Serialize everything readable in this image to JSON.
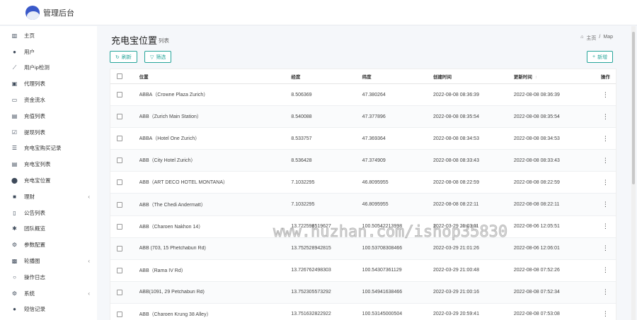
{
  "app": {
    "title": "管理后台"
  },
  "sidebar": {
    "items": [
      {
        "icon": "bar-chart-icon",
        "glyph": "▥",
        "label": "主页",
        "arrow": ""
      },
      {
        "icon": "user-icon",
        "glyph": "●",
        "label": "用户",
        "arrow": ""
      },
      {
        "icon": "ip-check-icon",
        "glyph": "⟋",
        "label": "用户ip检测",
        "arrow": ""
      },
      {
        "icon": "agent-list-icon",
        "glyph": "▣",
        "label": "代理列表",
        "arrow": ""
      },
      {
        "icon": "money-flow-icon",
        "glyph": "▭",
        "label": "资金流水",
        "arrow": ""
      },
      {
        "icon": "recharge-list-icon",
        "glyph": "▤",
        "label": "充值列表",
        "arrow": ""
      },
      {
        "icon": "withdraw-list-icon",
        "glyph": "☑",
        "label": "提现列表",
        "arrow": ""
      },
      {
        "icon": "purchase-record-icon",
        "glyph": "☰",
        "label": "充电宝购买记录",
        "arrow": ""
      },
      {
        "icon": "powerbank-list-icon",
        "glyph": "▤",
        "label": "充电宝列表",
        "arrow": ""
      },
      {
        "icon": "location-pin-icon",
        "glyph": "⬤",
        "label": "充电宝位置",
        "arrow": ""
      },
      {
        "icon": "finance-icon",
        "glyph": "■",
        "label": "理财",
        "arrow": "‹"
      },
      {
        "icon": "announcement-icon",
        "glyph": "▯",
        "label": "公告列表",
        "arrow": ""
      },
      {
        "icon": "team-icon",
        "glyph": "✱",
        "label": "团队概览",
        "arrow": ""
      },
      {
        "icon": "settings-icon",
        "glyph": "⚙",
        "label": "参数配置",
        "arrow": ""
      },
      {
        "icon": "carousel-icon",
        "glyph": "▩",
        "label": "轮播图",
        "arrow": "‹"
      },
      {
        "icon": "log-icon",
        "glyph": "○",
        "label": "操作日志",
        "arrow": ""
      },
      {
        "icon": "system-gear-icon",
        "glyph": "⚙",
        "label": "系统",
        "arrow": "‹"
      },
      {
        "icon": "sms-icon",
        "glyph": "●",
        "label": "短信记录",
        "arrow": ""
      }
    ]
  },
  "header": {
    "title": "充电宝位置",
    "subtitle": "列表",
    "breadcrumb": {
      "home": "主页",
      "sep": "/",
      "current": "Map"
    }
  },
  "toolbar": {
    "refresh_icon": "↻",
    "refresh_label": "刷新",
    "filter_icon": "▽",
    "filter_label": "筛选",
    "add_icon": "+",
    "add_label": "新增"
  },
  "table": {
    "columns": {
      "location": "位置",
      "longitude": "经度",
      "latitude": "纬度",
      "created": "创建时间",
      "updated": "更新时间",
      "actions": "操作"
    },
    "sort_glyph": "↑",
    "rows": [
      {
        "location": "ABBA（Crowne Plaza Zurich）",
        "lng": "8.506369",
        "lat": "47.380264",
        "created": "2022-08-08 08:36:39",
        "updated": "2022-08-08 08:36:39"
      },
      {
        "location": "ABB（Zurich Main Station）",
        "lng": "8.540088",
        "lat": "47.377896",
        "created": "2022-08-08 08:35:54",
        "updated": "2022-08-08 08:35:54"
      },
      {
        "location": "ABBA（Hotel One Zurich）",
        "lng": "8.533757",
        "lat": "47.369364",
        "created": "2022-08-08 08:34:53",
        "updated": "2022-08-08 08:34:53"
      },
      {
        "location": "ABB（City Hotel Zurich）",
        "lng": "8.536428",
        "lat": "47.374909",
        "created": "2022-08-08 08:33:43",
        "updated": "2022-08-08 08:33:43"
      },
      {
        "location": "ABB（ART DECO HOTEL MONTANA）",
        "lng": "7.1032295",
        "lat": "46.8095955",
        "created": "2022-08-08 08:22:59",
        "updated": "2022-08-08 08:22:59"
      },
      {
        "location": "ABB（The Chedi Andermatt）",
        "lng": "7.1032295",
        "lat": "46.8095955",
        "created": "2022-08-08 08:22:11",
        "updated": "2022-08-08 08:22:11"
      },
      {
        "location": "ABB（Charoen Nakhon 14）",
        "lng": "13.722598519627",
        "lat": "100.50542213998",
        "created": "2022-03-29 21:03:11",
        "updated": "2022-08-06 12:05:51"
      },
      {
        "location": "ABB (703, 15 Phetchaburi Rd)",
        "lng": "13.752528942815",
        "lat": "100.53708308466",
        "created": "2022-03-29 21:01:26",
        "updated": "2022-08-06 12:06:01"
      },
      {
        "location": "ABB（Rama IV Rd）",
        "lng": "13.726762498303",
        "lat": "100.54307361129",
        "created": "2022-03-29 21:00:48",
        "updated": "2022-08-08 07:52:26"
      },
      {
        "location": "ABB(1091, 29 Petchaburi Rd)",
        "lng": "13.752305573292",
        "lat": "100.54941638466",
        "created": "2022-03-29 21:00:16",
        "updated": "2022-08-08 07:52:34"
      },
      {
        "location": "ABB（Charoen Krung 38 Alley）",
        "lng": "13.751632822922",
        "lat": "100.53145000504",
        "created": "2022-03-29 20:59:41",
        "updated": "2022-08-08 07:53:08"
      }
    ],
    "row_action_glyph": "⋮"
  },
  "watermark": "www.huzhan.com/ishop35830"
}
